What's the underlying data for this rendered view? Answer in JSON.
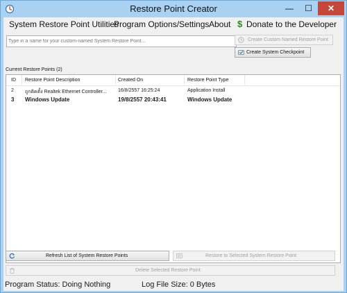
{
  "window": {
    "title": "Restore Point Creator",
    "min_glyph": "—",
    "max_glyph": "☐",
    "close_glyph": "✕"
  },
  "menu": {
    "utilities": "System Restore Point Utilities",
    "options": "Program Options/Settings",
    "about": "About",
    "donate": "Donate to the Developer",
    "donate_icon": "dollar-icon",
    "donate_color": "#2b8a1e"
  },
  "name_input": {
    "value": "",
    "placeholder": "Type in a name for your custom-named System Restore Point..."
  },
  "buttons": {
    "create_custom": "Create Custom Named Restore Point",
    "create_checkpoint": "Create System Checkpoint",
    "refresh": "Refresh List of System Restore Points",
    "restore_selected": "Restore to Selected System Restore Point",
    "delete_selected": "Delete Selected Restore Point"
  },
  "list": {
    "label": "Current Restore Points (2)",
    "columns": [
      "ID",
      "Restore Point Description",
      "Created On",
      "Restore Point Type"
    ],
    "rows": [
      {
        "id": "2",
        "description": "ถูกติดตั้ง Realtek Ethernet Controller...",
        "created": "16/8/2557 16:25:24",
        "type": "Application Install",
        "bold": false
      },
      {
        "id": "3",
        "description": "Windows Update",
        "created": "19/8/2557 20:43:41",
        "type": "Windows Update",
        "bold": true
      }
    ]
  },
  "status": {
    "program": "Program Status:  Doing Nothing",
    "logsize": "Log File Size:  0 Bytes"
  }
}
